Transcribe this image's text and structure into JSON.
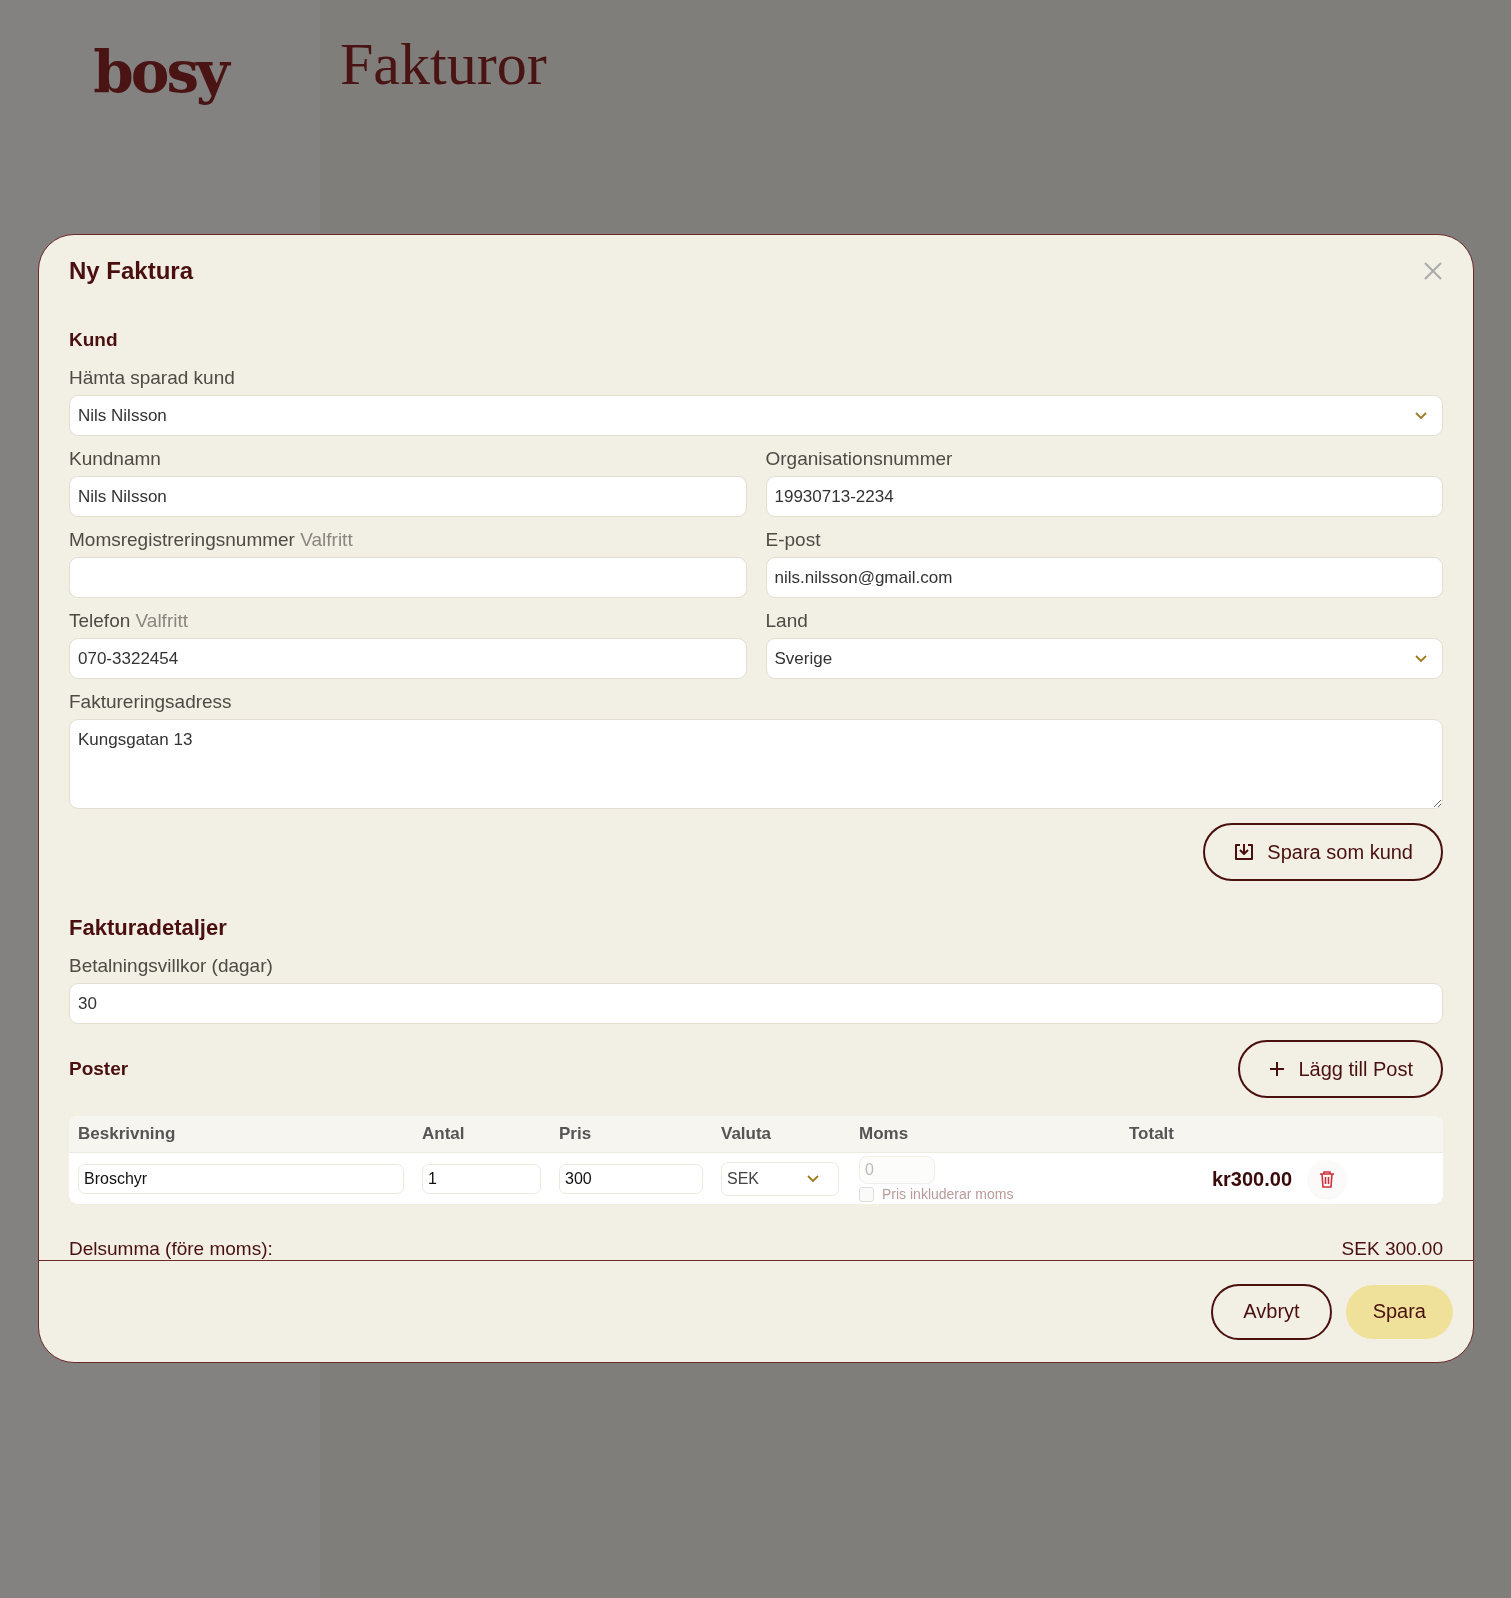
{
  "background": {
    "logo": "bosy",
    "title": "Fakturor"
  },
  "dialog": {
    "title": "Ny Faktura",
    "customer": {
      "heading": "Kund",
      "saved_customer": {
        "label": "Hämta sparad kund",
        "value": "Nils Nilsson"
      },
      "fields": [
        {
          "label": "Kundnamn",
          "value": "Nils Nilsson",
          "kind": "text"
        },
        {
          "label": "Organisationsnummer",
          "value": "19930713-2234",
          "kind": "text"
        },
        {
          "label": "Momsregistreringsnummer",
          "optional": "Valfritt",
          "kind": "text"
        },
        {
          "label": "E-post",
          "value": "nils.nilsson@gmail.com",
          "kind": "text"
        },
        {
          "label": "Telefon",
          "optional": "Valfritt",
          "value": "070-3322454",
          "kind": "text"
        },
        {
          "label": "Land",
          "value": "Sverige",
          "kind": "select"
        }
      ],
      "address": {
        "label": "Faktureringsadress",
        "value": "Kungsgatan 13"
      },
      "save_button": "Spara som kund"
    },
    "details": {
      "heading": "Fakturadetaljer",
      "payment_terms": {
        "label": "Betalningsvillkor (dagar)",
        "value": "30"
      }
    },
    "items": {
      "heading": "Poster",
      "add_button": "Lägg till Post",
      "columns": [
        "Beskrivning",
        "Antal",
        "Pris",
        "Valuta",
        "Moms",
        "Totalt"
      ],
      "rows": [
        {
          "description": "Broschyr",
          "quantity": "1",
          "price": "300",
          "currency": "SEK",
          "vat_placeholder": "0",
          "price_includes_vat": false,
          "vat_checkbox_label": "Pris inkluderar moms",
          "total": "kr300.00"
        }
      ]
    },
    "subtotal": {
      "label": "Delsumma (före moms):",
      "value": "SEK 300.00"
    },
    "buttons": {
      "cancel": "Avbryt",
      "save": "Spara"
    }
  }
}
